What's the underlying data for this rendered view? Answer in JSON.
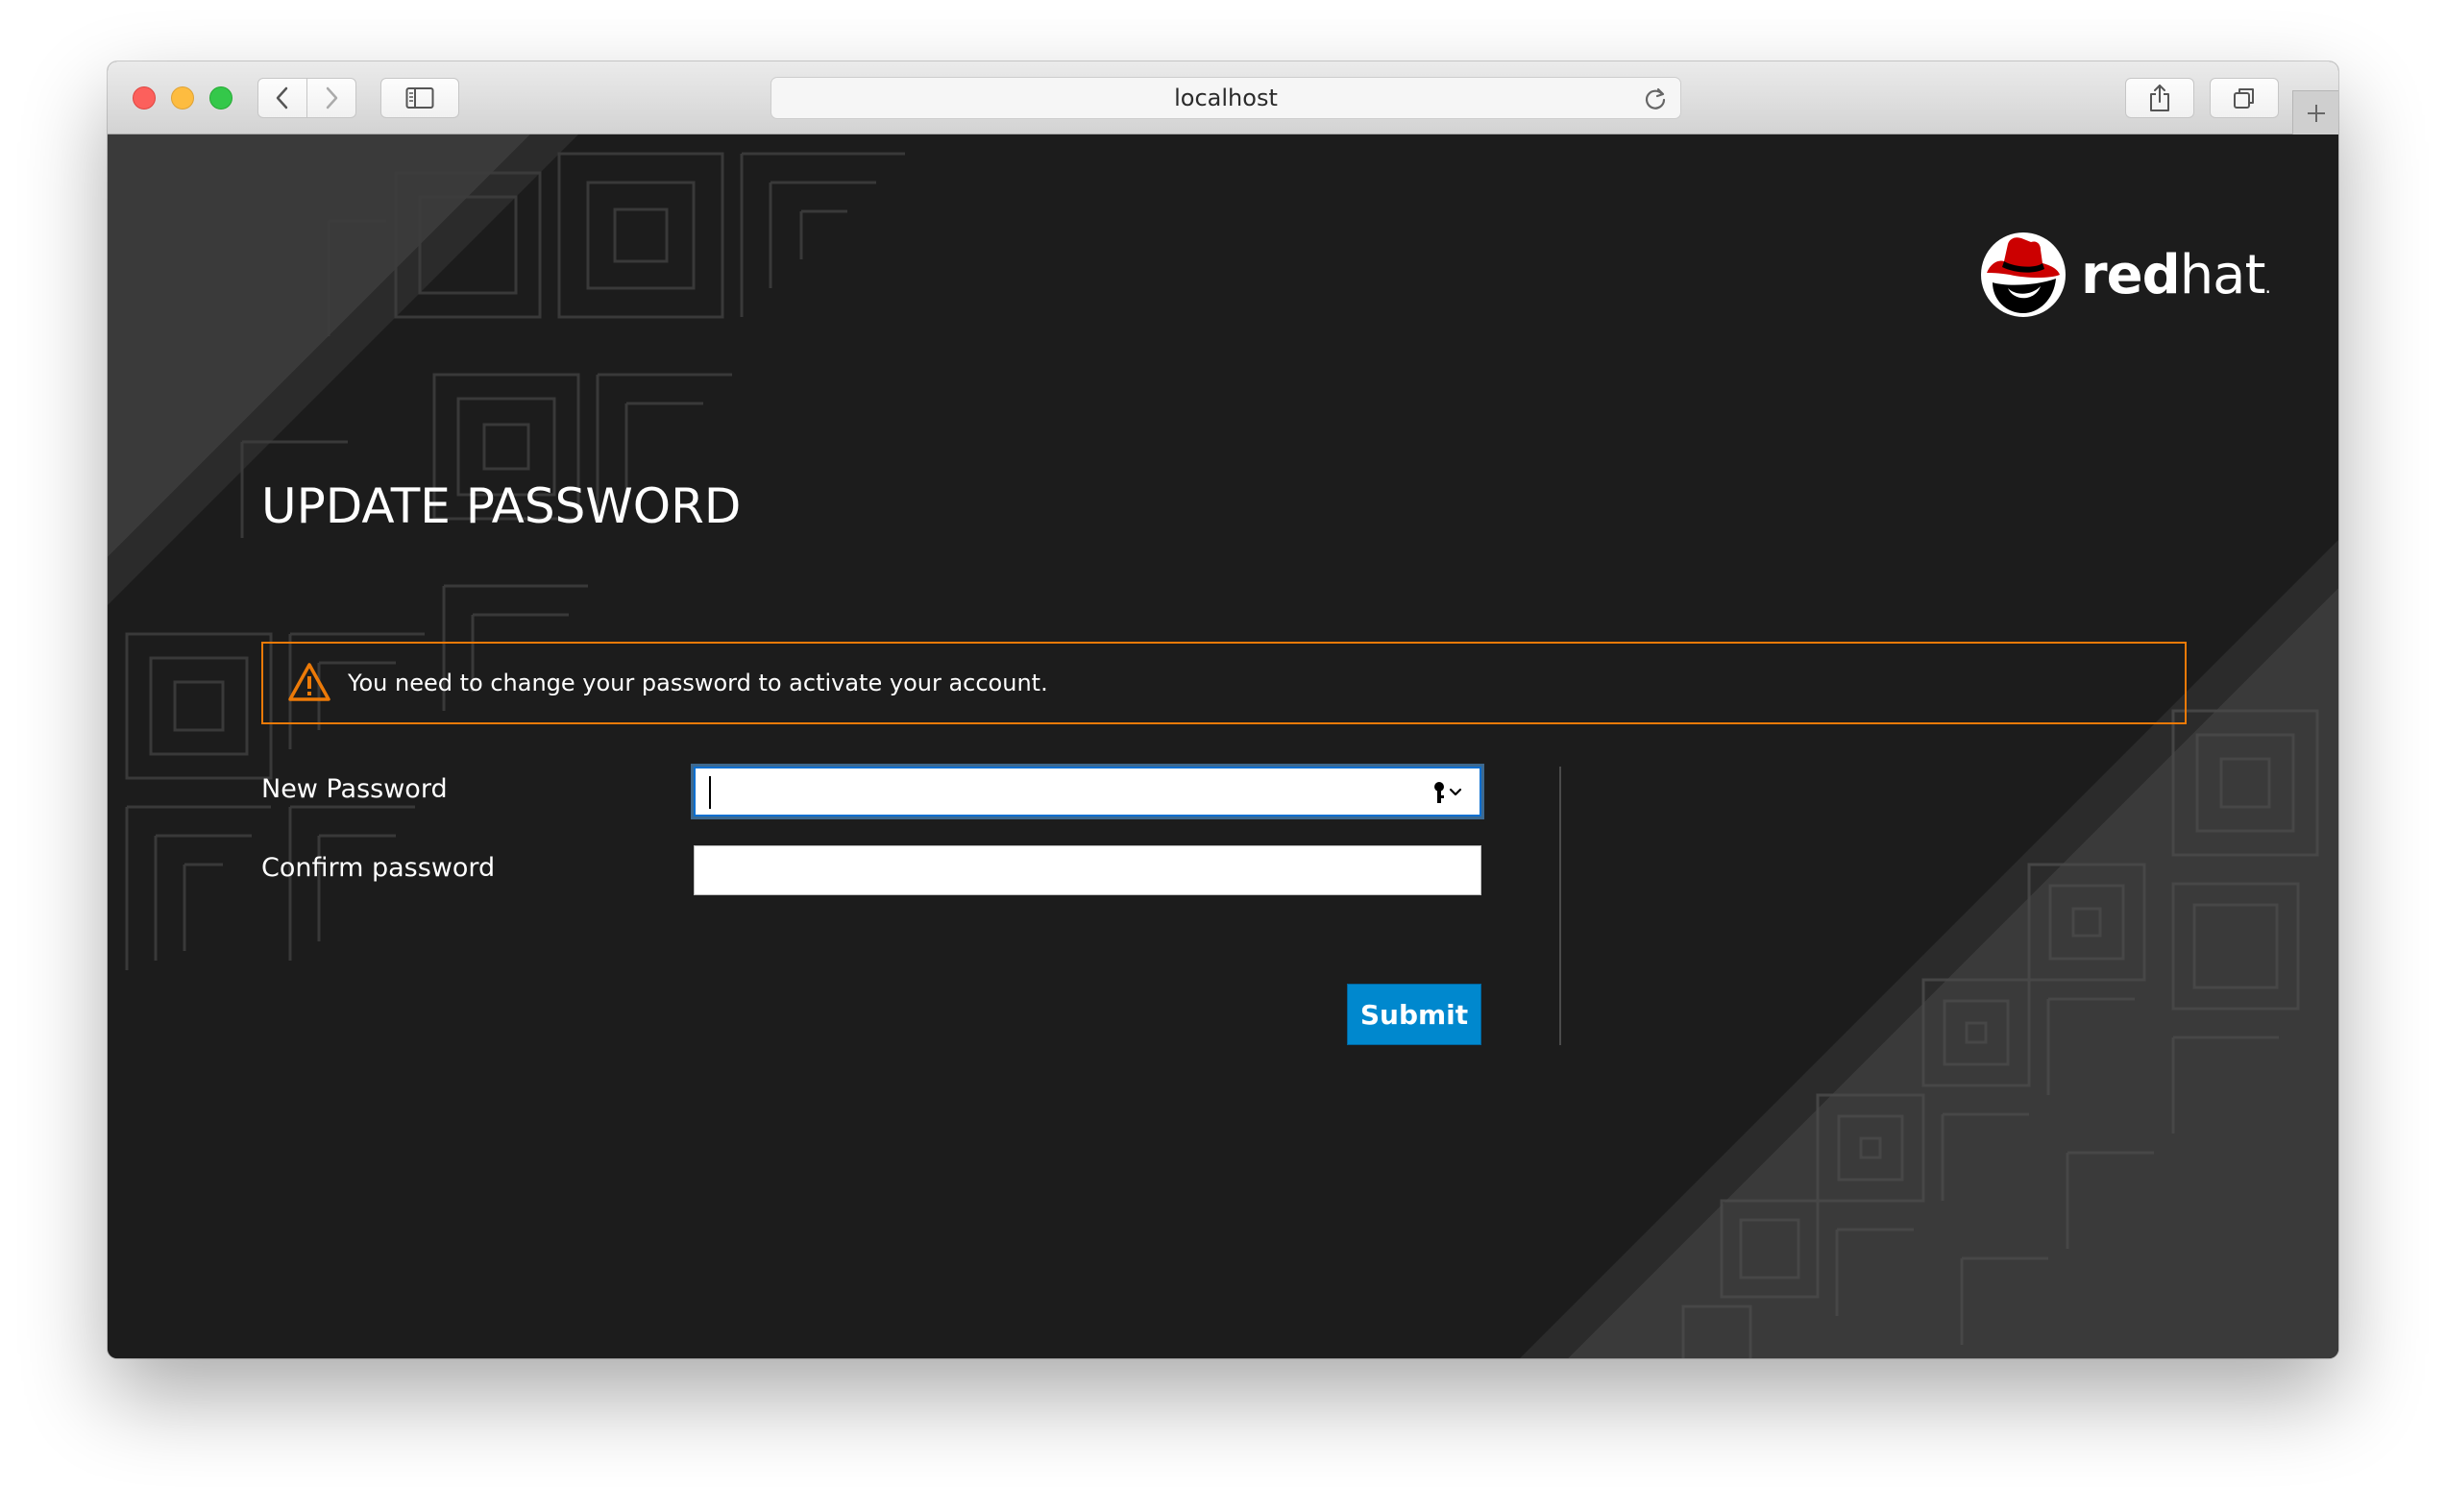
{
  "browser": {
    "url": "localhost",
    "colors": {
      "close": "#fc605c",
      "minimize": "#fdbc40",
      "zoom": "#34c84a"
    }
  },
  "brand": {
    "name_bold": "red",
    "name_light": "hat",
    "trademark": ".",
    "logo_color": "#cc0000"
  },
  "page": {
    "title": "UPDATE PASSWORD",
    "background": "#1c1c1c"
  },
  "alert": {
    "icon": "warning-triangle-icon",
    "message": "You need to change your password to activate your account.",
    "color": "#ec7a08"
  },
  "form": {
    "new_password_label": "New Password",
    "new_password_value": "",
    "confirm_password_label": "Confirm password",
    "confirm_password_value": "",
    "submit_label": "Submit",
    "submit_color": "#0088ce"
  }
}
